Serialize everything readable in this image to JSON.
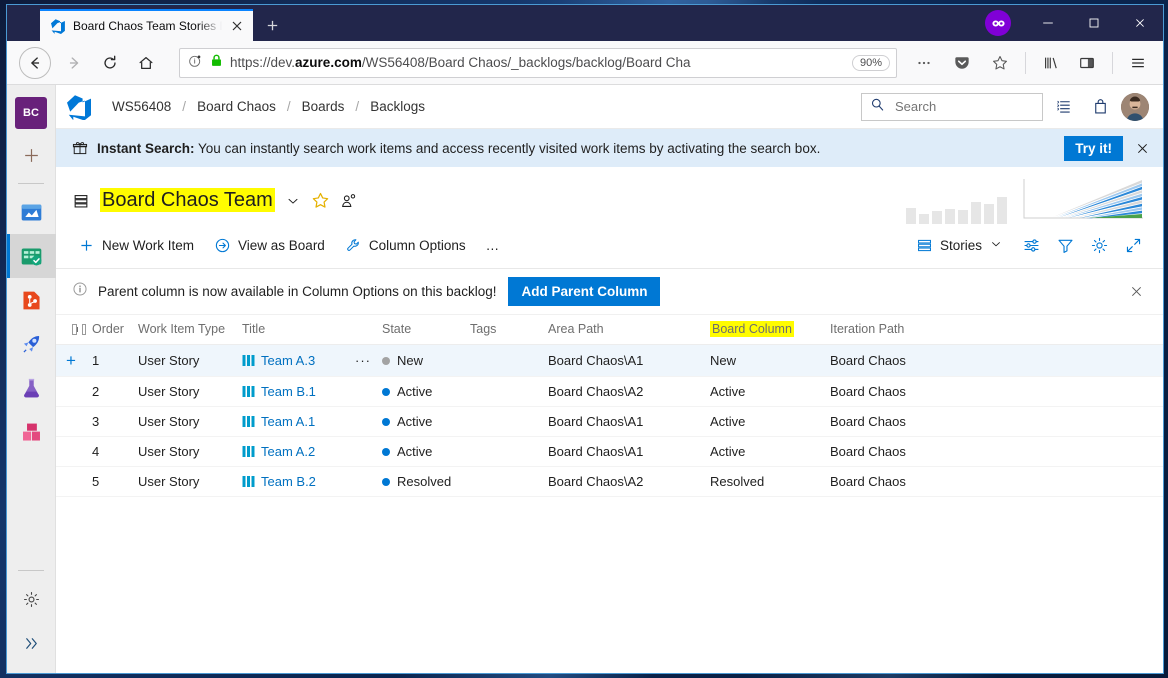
{
  "browser": {
    "tab": {
      "title": "Board Chaos Team Stories Back",
      "favicon": "azure-devops-favicon",
      "close_label": "✕"
    },
    "newtab_label": "+",
    "private_badge": "mask-icon",
    "window_controls": {
      "minimize": "─",
      "maximize": "☐",
      "close": "✕"
    },
    "nav": {
      "back": "back-arrow",
      "forward": "forward-arrow",
      "reload": "reload-icon",
      "home": "home-icon"
    },
    "url": {
      "scheme": "https://dev.",
      "domain": "azure.com",
      "path": "/WS56408/Board Chaos/_backlogs/backlog/Board Cha",
      "full": "https://dev.azure.com/WS56408/Board Chaos/_backlogs/backlog/Board Cha",
      "zoom": "90%",
      "info_icon": "page-info-icon",
      "lock_icon": "lock-icon"
    },
    "actions": {
      "more": "···",
      "pocket": "pocket-icon",
      "bookmark": "star-icon",
      "library": "library-icon",
      "sidebar": "sidebar-icon",
      "menu": "hamburger-menu-icon"
    }
  },
  "rail": {
    "project_initials": "BC",
    "new_label": "+",
    "items": [
      {
        "name": "overview",
        "label": "Overview"
      },
      {
        "name": "boards",
        "label": "Boards",
        "active": true
      },
      {
        "name": "repos",
        "label": "Repos"
      },
      {
        "name": "pipelines",
        "label": "Pipelines"
      },
      {
        "name": "test-plans",
        "label": "Test Plans"
      },
      {
        "name": "artifacts",
        "label": "Artifacts"
      }
    ],
    "settings_label": "Project settings",
    "expand_label": "»"
  },
  "header": {
    "logo": "azure-devops-logo",
    "breadcrumb": [
      {
        "label": "WS56408"
      },
      {
        "label": "Board Chaos"
      },
      {
        "label": "Boards"
      },
      {
        "label": "Backlogs"
      }
    ],
    "separator": "/",
    "search": {
      "placeholder": "Search",
      "value": ""
    },
    "icons": [
      {
        "name": "work-items-icon"
      },
      {
        "name": "marketplace-bag-icon"
      }
    ],
    "avatar": "user-avatar"
  },
  "banner": {
    "icon": "gift-icon",
    "title": "Instant Search:",
    "text": " You can instantly search work items and access recently visited work items by activating the search box.",
    "button": "Try it!",
    "close": "✕"
  },
  "backlog": {
    "view_icon": "backlog-list-icon",
    "team_name": "Board Chaos Team",
    "chevron": "chevron-down-icon",
    "favorite_icon": "star-icon",
    "team_members_icon": "team-members-icon",
    "charts": {
      "velocity_name": "velocity-chart",
      "cfd_name": "cumulative-flow-chart"
    },
    "commands": [
      {
        "name": "new-work-item",
        "label": "New Work Item",
        "icon": "plus-icon"
      },
      {
        "name": "view-as-board",
        "label": "View as Board",
        "icon": "arrow-circle-icon"
      },
      {
        "name": "column-options",
        "label": "Column Options",
        "icon": "wrench-icon"
      },
      {
        "name": "more-commands",
        "label": "…",
        "icon": "ellipsis-icon"
      }
    ],
    "level_picker": {
      "label": "Stories",
      "icon": "backlog-levels-icon",
      "chevron": "chevron-down-icon"
    },
    "right_icons": [
      {
        "name": "view-options-icon"
      },
      {
        "name": "filter-icon"
      },
      {
        "name": "settings-gear-icon"
      },
      {
        "name": "fullscreen-icon"
      }
    ]
  },
  "parent_note": {
    "icon": "info-icon",
    "text": "Parent column is now available in Column Options on this backlog!",
    "button": "Add Parent Column",
    "close": "✕"
  },
  "grid": {
    "expand_all": "+",
    "collapse_all": "−",
    "columns": [
      {
        "key": "order",
        "label": "Order"
      },
      {
        "key": "type",
        "label": "Work Item Type"
      },
      {
        "key": "title",
        "label": "Title"
      },
      {
        "key": "state",
        "label": "State"
      },
      {
        "key": "tags",
        "label": "Tags"
      },
      {
        "key": "area",
        "label": "Area Path"
      },
      {
        "key": "board",
        "label": "Board Column",
        "highlighted": true
      },
      {
        "key": "iteration",
        "label": "Iteration Path"
      }
    ],
    "rows": [
      {
        "order": "1",
        "type": "User Story",
        "title": "Team A.3",
        "state": "New",
        "state_color": "#a3a3a3",
        "tags": "",
        "area": "Board Chaos\\A1",
        "board": "New",
        "iteration": "Board Chaos",
        "selected": true,
        "row_plus": "+",
        "menu": "···"
      },
      {
        "order": "2",
        "type": "User Story",
        "title": "Team B.1",
        "state": "Active",
        "state_color": "#0078d4",
        "tags": "",
        "area": "Board Chaos\\A2",
        "board": "Active",
        "iteration": "Board Chaos",
        "selected": false,
        "row_plus": "",
        "menu": ""
      },
      {
        "order": "3",
        "type": "User Story",
        "title": "Team A.1",
        "state": "Active",
        "state_color": "#0078d4",
        "tags": "",
        "area": "Board Chaos\\A1",
        "board": "Active",
        "iteration": "Board Chaos",
        "selected": false,
        "row_plus": "",
        "menu": ""
      },
      {
        "order": "4",
        "type": "User Story",
        "title": "Team A.2",
        "state": "Active",
        "state_color": "#0078d4",
        "tags": "",
        "area": "Board Chaos\\A1",
        "board": "Active",
        "iteration": "Board Chaos",
        "selected": false,
        "row_plus": "",
        "menu": ""
      },
      {
        "order": "5",
        "type": "User Story",
        "title": "Team B.2",
        "state": "Resolved",
        "state_color": "#0078d4",
        "tags": "",
        "area": "Board Chaos\\A2",
        "board": "Resolved",
        "iteration": "Board Chaos",
        "selected": false,
        "row_plus": "",
        "menu": ""
      }
    ]
  },
  "colors": {
    "accent": "#0078d4",
    "highlight": "#fffc00",
    "banner_bg": "#deecf9",
    "row_selected": "#eff6fc",
    "link": "#0070c0"
  }
}
